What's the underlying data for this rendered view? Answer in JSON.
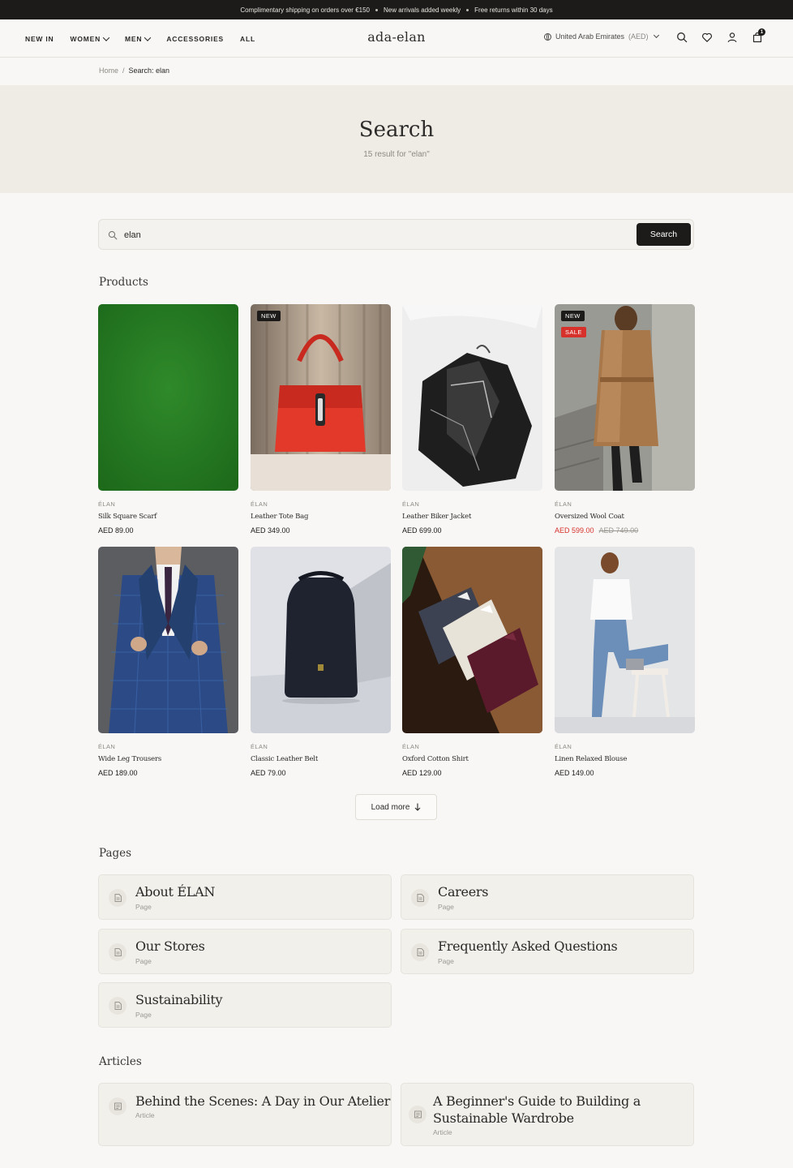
{
  "promo": {
    "items": [
      "Complimentary shipping on orders over €150",
      "New arrivals added weekly",
      "Free returns within 30 days"
    ]
  },
  "header": {
    "nav": [
      {
        "label": "NEW IN",
        "dropdown": false
      },
      {
        "label": "WOMEN",
        "dropdown": true
      },
      {
        "label": "MEN",
        "dropdown": true
      },
      {
        "label": "ACCESSORIES",
        "dropdown": false
      },
      {
        "label": "ALL",
        "dropdown": false
      }
    ],
    "logo": "ada-elan",
    "locale": {
      "country": "United Arab Emirates",
      "currency": "(AED)"
    },
    "icons": [
      "search-icon",
      "heart-icon",
      "user-icon",
      "bag-icon"
    ],
    "cart_count": "1"
  },
  "breadcrumb": {
    "home": "Home",
    "separator": "/",
    "current": "Search: elan"
  },
  "hero": {
    "title": "Search",
    "subtitle": "15 result for \"elan\""
  },
  "search": {
    "value": "elan",
    "button": "Search"
  },
  "sections": {
    "products": "Products",
    "pages": "Pages",
    "articles": "Articles"
  },
  "products": [
    {
      "brand": "ÉLAN",
      "name": "Silk Square Scarf",
      "price": "AED 89.00",
      "badges": []
    },
    {
      "brand": "ÉLAN",
      "name": "Leather Tote Bag",
      "price": "AED 349.00",
      "badges": [
        "NEW"
      ]
    },
    {
      "brand": "ÉLAN",
      "name": "Leather Biker Jacket",
      "price": "AED 699.00",
      "badges": []
    },
    {
      "brand": "ÉLAN",
      "name": "Oversized Wool Coat",
      "price": "AED 599.00",
      "was": "AED 749.00",
      "badges": [
        "NEW",
        "SALE"
      ]
    },
    {
      "brand": "ÉLAN",
      "name": "Wide Leg Trousers",
      "price": "AED 189.00",
      "badges": []
    },
    {
      "brand": "ÉLAN",
      "name": "Classic Leather Belt",
      "price": "AED 79.00",
      "badges": []
    },
    {
      "brand": "ÉLAN",
      "name": "Oxford Cotton Shirt",
      "price": "AED 129.00",
      "badges": []
    },
    {
      "brand": "ÉLAN",
      "name": "Linen Relaxed Blouse",
      "price": "AED 149.00",
      "badges": []
    }
  ],
  "load_more": "Load more",
  "pages": [
    {
      "title": "About ÉLAN",
      "type": "Page"
    },
    {
      "title": "Careers",
      "type": "Page"
    },
    {
      "title": "Our Stores",
      "type": "Page"
    },
    {
      "title": "Frequently Asked Questions",
      "type": "Page"
    },
    {
      "title": "Sustainability",
      "type": "Page"
    }
  ],
  "articles": [
    {
      "title": "Behind the Scenes: A Day in Our Atelier",
      "type": "Article"
    },
    {
      "title_line1": "A Beginner's Guide to Building a",
      "title_line2": "Sustainable Wardrobe",
      "type": "Article"
    }
  ],
  "colors": {
    "accent": "#1c1b19",
    "sale": "#d6312b",
    "background": "#f8f7f5",
    "hero": "#efece6"
  }
}
